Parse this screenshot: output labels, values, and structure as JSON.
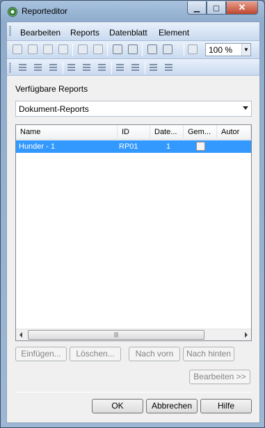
{
  "window": {
    "title": "Reporteditor"
  },
  "menubar": {
    "items": [
      "Bearbeiten",
      "Reports",
      "Datenblatt",
      "Element"
    ]
  },
  "toolbar": {
    "zoom_value": "100 %"
  },
  "reports": {
    "label": "Verfügbare Reports",
    "selected_type": "Dokument-Reports",
    "columns": [
      "Name",
      "ID",
      "Date...",
      "Gem...",
      "Autor"
    ],
    "rows": [
      {
        "name": "Hunder - 1",
        "id": "RP01",
        "date": "1",
        "shared": false,
        "author": ""
      }
    ]
  },
  "buttons": {
    "insert": "Einfügen...",
    "delete": "Löschen...",
    "move_up": "Nach vorn",
    "move_down": "Nach hinten",
    "edit": "Bearbeiten >>",
    "ok": "OK",
    "cancel": "Abbrechen",
    "help": "Hilfe"
  }
}
